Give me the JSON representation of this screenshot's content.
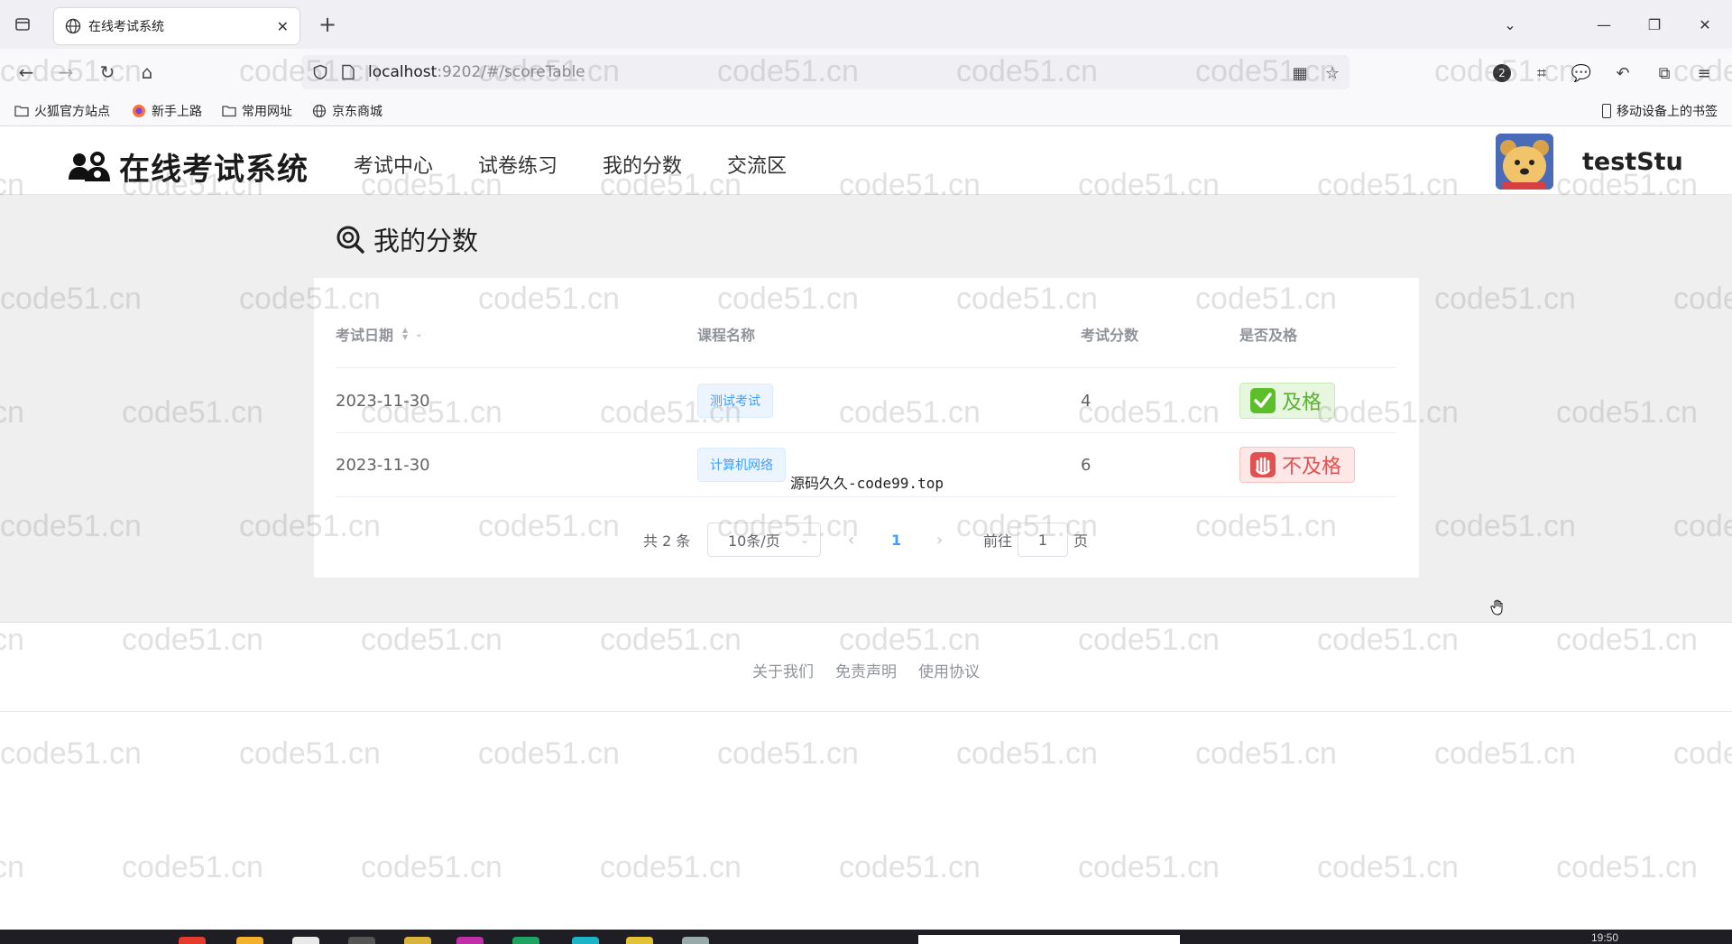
{
  "browser": {
    "tab_title": "在线考试系统",
    "url_host": "localhost",
    "url_path": ":9202/#/scoreTable",
    "toolbar_badge": "2",
    "bookmarks": [
      "火狐官方站点",
      "新手上路",
      "常用网址",
      "京东商城"
    ],
    "bookmarks_right": "移动设备上的书签"
  },
  "site": {
    "logo_text": "在线考试系统",
    "menu": [
      "考试中心",
      "试卷练习",
      "我的分数",
      "交流区"
    ],
    "username": "testStu"
  },
  "main": {
    "title": "我的分数",
    "columns": [
      "考试日期",
      "课程名称",
      "考试分数",
      "是否及格"
    ],
    "rows": [
      {
        "date": "2023-11-30",
        "course": "测试考试",
        "score": "4",
        "result": "及格",
        "passed": true
      },
      {
        "date": "2023-11-30",
        "course": "计算机网络",
        "score": "6",
        "result": "不及格",
        "passed": false
      }
    ],
    "pagination": {
      "total": "共 2 条",
      "page_size": "10条/页",
      "prev": "‹",
      "current": "1",
      "next": "›",
      "goto_label": "前往",
      "goto_value": "1",
      "goto_suffix": "页"
    }
  },
  "overlay_text": "源码久久-code99.top",
  "footer": {
    "links": [
      "关于我们",
      "免责声明",
      "使用协议"
    ]
  },
  "taskbar": {
    "time": "19:50"
  },
  "watermark": "code51.cn",
  "colors": {
    "accent": "#409eff",
    "pass": "#59b32f",
    "fail": "#e05252",
    "page_bg": "#efefef"
  }
}
